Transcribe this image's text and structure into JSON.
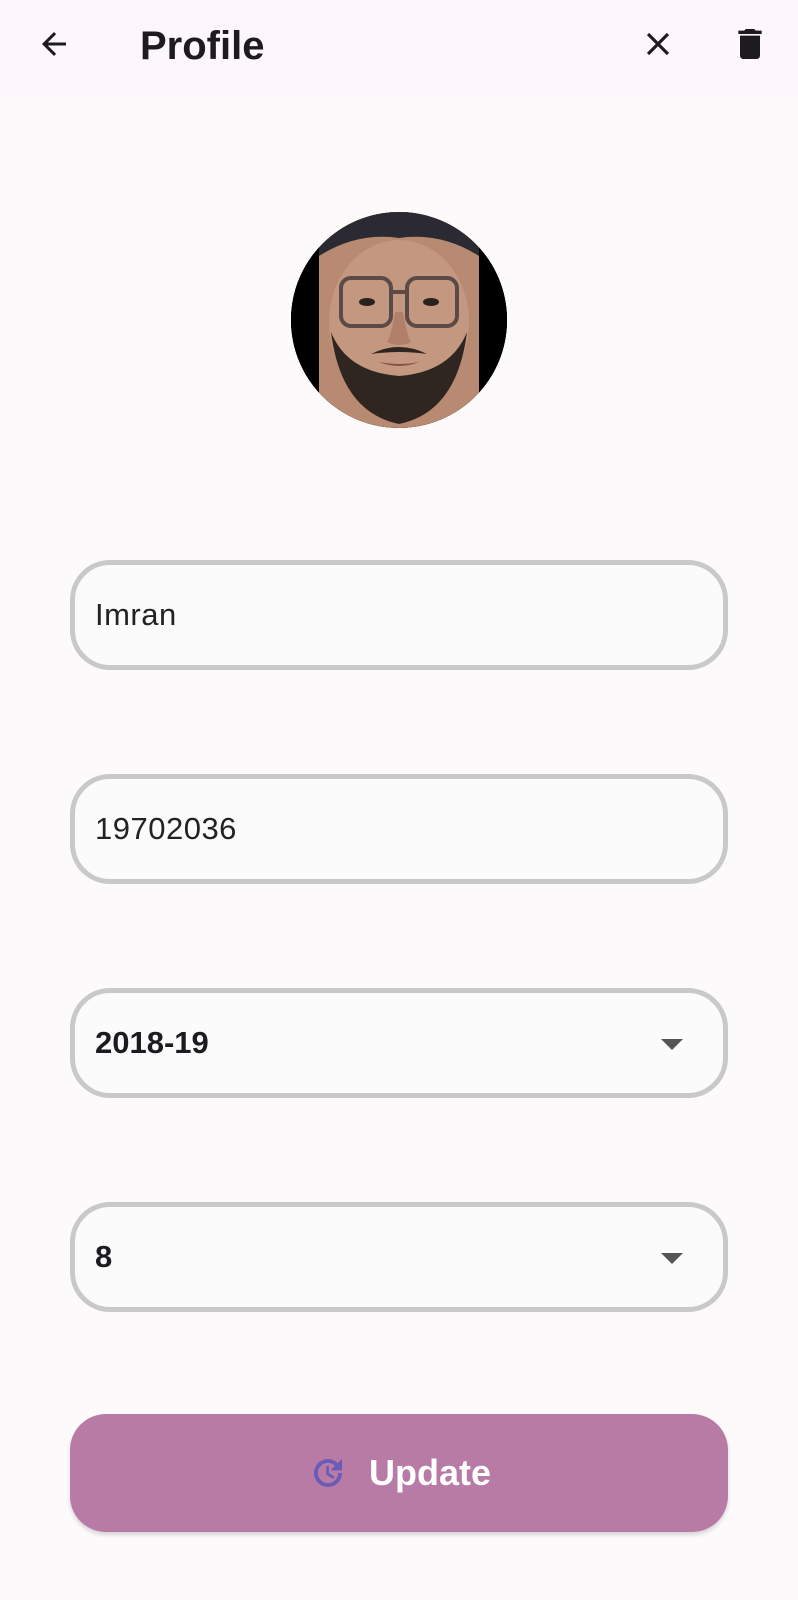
{
  "appbar": {
    "title": "Profile",
    "back_icon": "arrow-left-icon",
    "close_icon": "close-icon",
    "delete_icon": "trash-icon"
  },
  "avatar": {
    "icon": "user-avatar-photo"
  },
  "form": {
    "name_value": "Imran",
    "id_value": "19702036",
    "session_value": "2018-19",
    "semester_value": "8"
  },
  "update_button": {
    "label": "Update",
    "icon": "refresh-icon",
    "background": "#b77ba6",
    "icon_color": "#6a5bb7"
  }
}
